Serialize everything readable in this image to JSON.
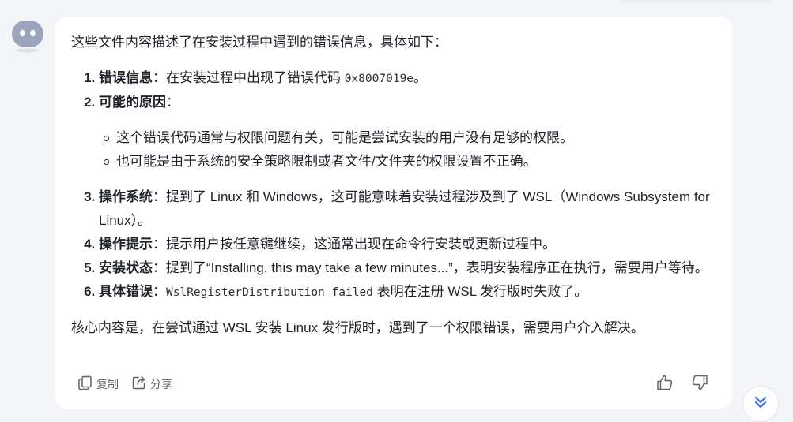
{
  "message": {
    "intro": "这些文件内容描述了在安装过程中遇到的错误信息，具体如下：",
    "items": [
      {
        "label": "错误信息",
        "sep": "：",
        "text_before": "在安装过程中出现了错误代码 ",
        "code": "0x8007019e",
        "text_after": "。"
      },
      {
        "label": "可能的原因",
        "sep": "：",
        "sub": [
          "这个错误代码通常与权限问题有关，可能是尝试安装的用户没有足够的权限。",
          "也可能是由于系统的安全策略限制或者文件/文件夹的权限设置不正确。"
        ]
      },
      {
        "label": "操作系统",
        "sep": "：",
        "text": "提到了 Linux 和 Windows，这可能意味着安装过程涉及到了 WSL（Windows Subsystem for Linux）。"
      },
      {
        "label": "操作提示",
        "sep": "：",
        "text": "提示用户按任意键继续，这通常出现在命令行安装或更新过程中。"
      },
      {
        "label": "安装状态",
        "sep": "：",
        "text": "提到了“Installing, this may take a few minutes...”，表明安装程序正在执行，需要用户等待。"
      },
      {
        "label": "具体错误",
        "sep": "：",
        "code": "WslRegisterDistribution failed",
        "text_after": " 表明在注册 WSL 发行版时失败了。"
      }
    ],
    "summary": "核心内容是，在尝试通过 WSL 安装 Linux 发行版时，遇到了一个权限错误，需要用户介入解决。"
  },
  "actions": {
    "copy_label": "复制",
    "share_label": "分享"
  },
  "icons": {
    "avatar": "bot-avatar-icon",
    "copy": "copy-icon",
    "share": "share-icon",
    "like": "thumbs-up-icon",
    "dislike": "thumbs-down-icon",
    "scroll": "double-chevron-down-icon"
  },
  "colors": {
    "background": "#f4f5f9",
    "card": "#ffffff",
    "text": "#1f2329",
    "muted": "#5f6368",
    "accent": "#3b6df2",
    "avatar": "#9aa4ba"
  }
}
